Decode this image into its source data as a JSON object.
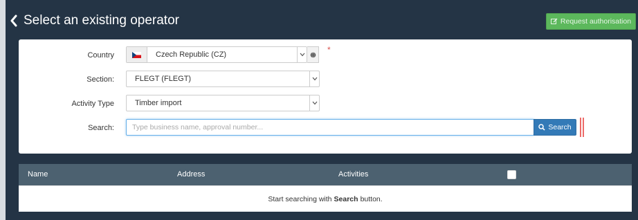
{
  "header": {
    "title": "Select an existing operator",
    "request_button_label": "Request authorisation"
  },
  "form": {
    "country": {
      "label": "Country",
      "value": "Czech Republic (CZ)",
      "flag": "cz-flag-icon",
      "required_marker": "*"
    },
    "section": {
      "label": "Section:",
      "value": "FLEGT (FLEGT)"
    },
    "activity_type": {
      "label": "Activity Type",
      "value": "Timber import"
    },
    "search": {
      "label": "Search:",
      "placeholder": "Type business name, approval number...",
      "button_label": "Search"
    }
  },
  "table": {
    "columns": [
      "Name",
      "Address",
      "Activities"
    ],
    "empty_message": {
      "prefix": "Start searching with",
      "emphasis": "Search",
      "suffix": "button."
    }
  },
  "colors": {
    "background": "#243445",
    "request_button": "#5cb85c",
    "search_button": "#337ab7",
    "table_header": "#4c6170",
    "required": "#d9534f"
  }
}
